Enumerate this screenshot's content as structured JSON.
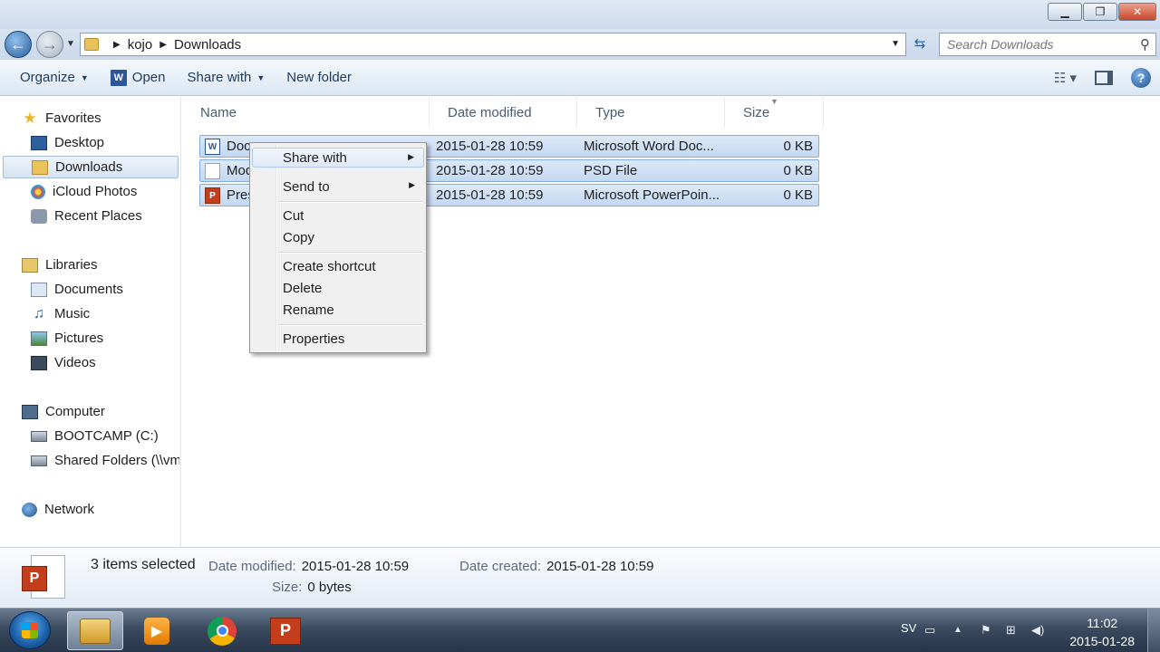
{
  "address": {
    "crumbs": [
      "kojo",
      "Downloads"
    ],
    "search_placeholder": "Search Downloads"
  },
  "toolbar": {
    "organize": "Organize",
    "open": "Open",
    "share_with": "Share with",
    "new_folder": "New folder"
  },
  "nav": {
    "favorites": "Favorites",
    "desktop": "Desktop",
    "downloads": "Downloads",
    "icloud": "iCloud Photos",
    "recent": "Recent Places",
    "libraries": "Libraries",
    "documents": "Documents",
    "music": "Music",
    "pictures": "Pictures",
    "videos": "Videos",
    "computer": "Computer",
    "bootcamp": "BOOTCAMP (C:)",
    "shared": "Shared Folders (\\\\vm",
    "network": "Network"
  },
  "columns": {
    "name": "Name",
    "date": "Date modified",
    "type": "Type",
    "size": "Size"
  },
  "files": [
    {
      "name": "Doc",
      "date": "2015-01-28 10:59",
      "type": "Microsoft Word Doc...",
      "size": "0 KB"
    },
    {
      "name": "Mod",
      "date": "2015-01-28 10:59",
      "type": "PSD File",
      "size": "0 KB"
    },
    {
      "name": "Pres",
      "date": "2015-01-28 10:59",
      "type": "Microsoft PowerPoin...",
      "size": "0 KB"
    }
  ],
  "context_menu": {
    "share_with": "Share with",
    "send_to": "Send to",
    "cut": "Cut",
    "copy": "Copy",
    "create_shortcut": "Create shortcut",
    "delete": "Delete",
    "rename": "Rename",
    "properties": "Properties"
  },
  "details": {
    "count": "3 items selected",
    "date_modified_label": "Date modified:",
    "date_modified": "2015-01-28 10:59",
    "date_created_label": "Date created:",
    "date_created": "2015-01-28 10:59",
    "size_label": "Size:",
    "size": "0 bytes"
  },
  "taskbar": {
    "lang": "SV",
    "time": "11:02",
    "date": "2015-01-28"
  }
}
